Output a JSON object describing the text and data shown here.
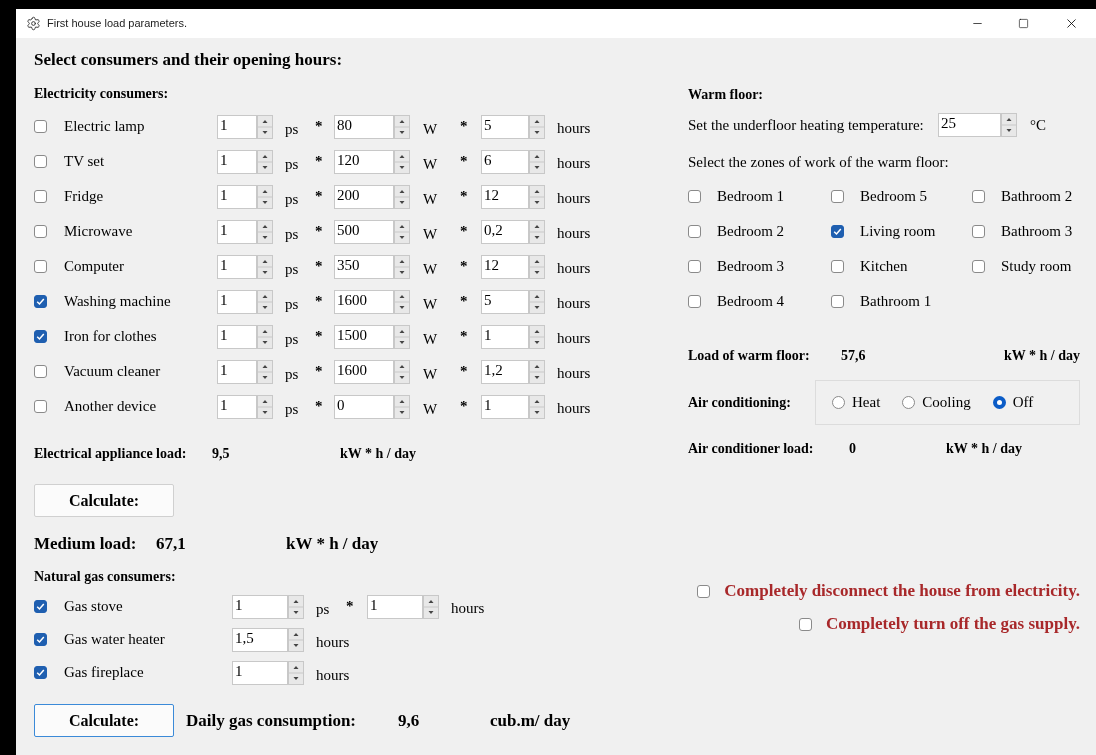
{
  "window": {
    "title": "First house load parameters."
  },
  "heading": "Select consumers and their opening hours:",
  "electricity": {
    "title": "Electricity consumers:",
    "rows": [
      {
        "name": "Electric lamp",
        "checked": false,
        "count": "1",
        "count_unit": "ps",
        "multiply_1": "*",
        "power": "80",
        "power_unit": "W",
        "multiply_2": "*",
        "hours": "5",
        "hours_unit": "hours"
      },
      {
        "name": "TV set",
        "checked": false,
        "count": "1",
        "count_unit": "ps",
        "multiply_1": "*",
        "power": "120",
        "power_unit": "W",
        "multiply_2": "*",
        "hours": "6",
        "hours_unit": "hours"
      },
      {
        "name": "Fridge",
        "checked": false,
        "count": "1",
        "count_unit": "ps",
        "multiply_1": "*",
        "power": "200",
        "power_unit": "W",
        "multiply_2": "*",
        "hours": "12",
        "hours_unit": "hours"
      },
      {
        "name": "Microwave",
        "checked": false,
        "count": "1",
        "count_unit": "ps",
        "multiply_1": "*",
        "power": "500",
        "power_unit": "W",
        "multiply_2": "*",
        "hours": "0,2",
        "hours_unit": "hours"
      },
      {
        "name": "Computer",
        "checked": false,
        "count": "1",
        "count_unit": "ps",
        "multiply_1": "*",
        "power": "350",
        "power_unit": "W",
        "multiply_2": "*",
        "hours": "12",
        "hours_unit": "hours"
      },
      {
        "name": "Washing machine",
        "checked": true,
        "count": "1",
        "count_unit": "ps",
        "multiply_1": "*",
        "power": "1600",
        "power_unit": "W",
        "multiply_2": "*",
        "hours": "5",
        "hours_unit": "hours"
      },
      {
        "name": "Iron for clothes",
        "checked": true,
        "count": "1",
        "count_unit": "ps",
        "multiply_1": "*",
        "power": "1500",
        "power_unit": "W",
        "multiply_2": "*",
        "hours": "1",
        "hours_unit": "hours"
      },
      {
        "name": "Vacuum cleaner",
        "checked": false,
        "count": "1",
        "count_unit": "ps",
        "multiply_1": "*",
        "power": "1600",
        "power_unit": "W",
        "multiply_2": "*",
        "hours": "1,2",
        "hours_unit": "hours"
      },
      {
        "name": "Another device",
        "checked": false,
        "count": "1",
        "count_unit": "ps",
        "multiply_1": "*",
        "power": "0",
        "power_unit": "W",
        "multiply_2": "*",
        "hours": "1",
        "hours_unit": "hours"
      }
    ],
    "load": {
      "label": "Electrical appliance load:",
      "value": "9,5",
      "unit": "kW * h / day"
    },
    "calculate_button": "Calculate:"
  },
  "medium_load": {
    "label": "Medium load:",
    "value": "67,1",
    "unit": "kW * h / day"
  },
  "gas": {
    "title": "Natural gas consumers:",
    "rows": [
      {
        "kind": "count_hours",
        "name": "Gas stove",
        "checked": true,
        "count": "1",
        "count_unit": "ps",
        "multiply": "*",
        "hours": "1",
        "hours_unit": "hours"
      },
      {
        "kind": "hours",
        "name": "Gas water heater",
        "checked": true,
        "hours": "1,5",
        "hours_unit": "hours"
      },
      {
        "kind": "hours",
        "name": "Gas fireplace",
        "checked": true,
        "hours": "1",
        "hours_unit": "hours"
      }
    ],
    "calculate_button": "Calculate:",
    "result": {
      "label": "Daily gas consumption:",
      "value": "9,6",
      "unit": "cub.m/ day"
    }
  },
  "warm_floor": {
    "title": "Warm floor:",
    "temperature_label": "Set the underfloor heating temperature:",
    "temperature": "25",
    "temperature_unit": "°C",
    "zones_label": "Select the zones of work of the warm floor:",
    "zones": [
      {
        "label": "Bedroom 1",
        "checked": false
      },
      {
        "label": "Bedroom 5",
        "checked": false
      },
      {
        "label": "Bathroom 2",
        "checked": false
      },
      {
        "label": "Bedroom 2",
        "checked": false
      },
      {
        "label": "Living room",
        "checked": true
      },
      {
        "label": "Bathroom 3",
        "checked": false
      },
      {
        "label": "Bedroom 3",
        "checked": false
      },
      {
        "label": "Kitchen",
        "checked": false
      },
      {
        "label": "Study room",
        "checked": false
      },
      {
        "label": "Bedroom 4",
        "checked": false
      },
      {
        "label": "Bathroom 1",
        "checked": false
      }
    ],
    "load": {
      "label": "Load of warm floor:",
      "value": "57,6",
      "unit": "kW * h / day"
    }
  },
  "air_conditioning": {
    "label": "Air conditioning:",
    "options": [
      {
        "label": "Heat",
        "selected": false
      },
      {
        "label": "Cooling",
        "selected": false
      },
      {
        "label": "Off",
        "selected": true
      }
    ],
    "load": {
      "label": "Air conditioner load:",
      "value": "0",
      "unit": "kW * h / day"
    }
  },
  "shutoffs": [
    {
      "label": "Completely disconnect the house from electricity.",
      "checked": false
    },
    {
      "label": "Completely turn off the gas supply.",
      "checked": false
    }
  ]
}
